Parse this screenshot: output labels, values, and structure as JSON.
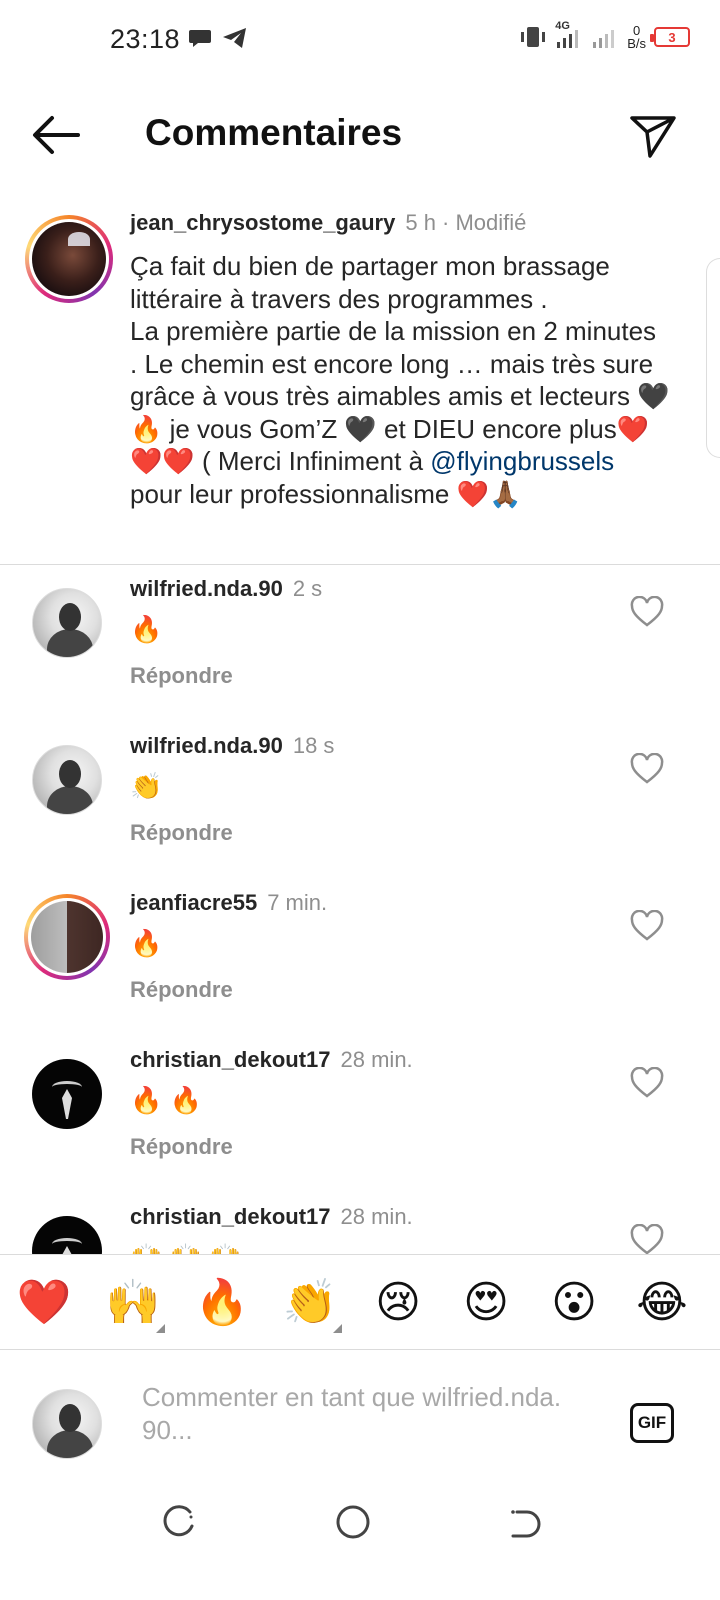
{
  "status_bar": {
    "time": "23:18",
    "network": "4G",
    "speed_value": "0",
    "speed_unit": "B/s",
    "battery": "3"
  },
  "header": {
    "title": "Commentaires"
  },
  "caption": {
    "username": "jean_chrysostome_gaury",
    "meta": "5 h · Modifié",
    "text_before_mention": "Ça fait du bien de partager mon brassage littéraire à travers des programmes .\nLa première partie de la mission en 2 minutes . Le chemin est encore long … mais très sure grâce à vous très aimables amis et lecteurs 🖤🔥 je vous Gom’Z 🖤 et DIEU encore plus❤️❤️❤️ ( Merci Infiniment à ",
    "mention": "@flyingbrussels",
    "text_after_mention": "  pour leur professionnalisme ❤️🙏🏾"
  },
  "comments": [
    {
      "username": "wilfried.nda.90",
      "time": "2 s",
      "text": "🔥",
      "reply": "Répondre",
      "avatar": "plain"
    },
    {
      "username": "wilfried.nda.90",
      "time": "18 s",
      "text": "👏",
      "reply": "Répondre",
      "avatar": "plain"
    },
    {
      "username": "jeanfiacre55",
      "time": "7 min.",
      "text": "🔥",
      "reply": "Répondre",
      "avatar": "ring"
    },
    {
      "username": "christian_dekout17",
      "time": "28 min.",
      "text": "🔥 🔥",
      "reply": "Répondre",
      "avatar": "dark"
    },
    {
      "username": "christian_dekout17",
      "time": "28 min.",
      "text": "🙌 🙌 🙌",
      "reply": "",
      "avatar": "dark"
    }
  ],
  "emoji_bar": [
    "❤️",
    "🙌",
    "🔥",
    "👏",
    "😢",
    "😍",
    "😮",
    "😂"
  ],
  "composer": {
    "placeholder": "Commenter en tant que wilfried.nda.\n90...",
    "gif_label": "GIF"
  },
  "colors": {
    "mention": "#00376b",
    "secondary_text": "#8e8e8e",
    "story_ring": "#dd2a7b",
    "battery_low": "#e53935"
  },
  "icons": [
    "back-arrow-icon",
    "send-icon",
    "heart-outline-icon",
    "gif-icon",
    "recent-apps-icon",
    "home-icon",
    "back-nav-icon"
  ]
}
